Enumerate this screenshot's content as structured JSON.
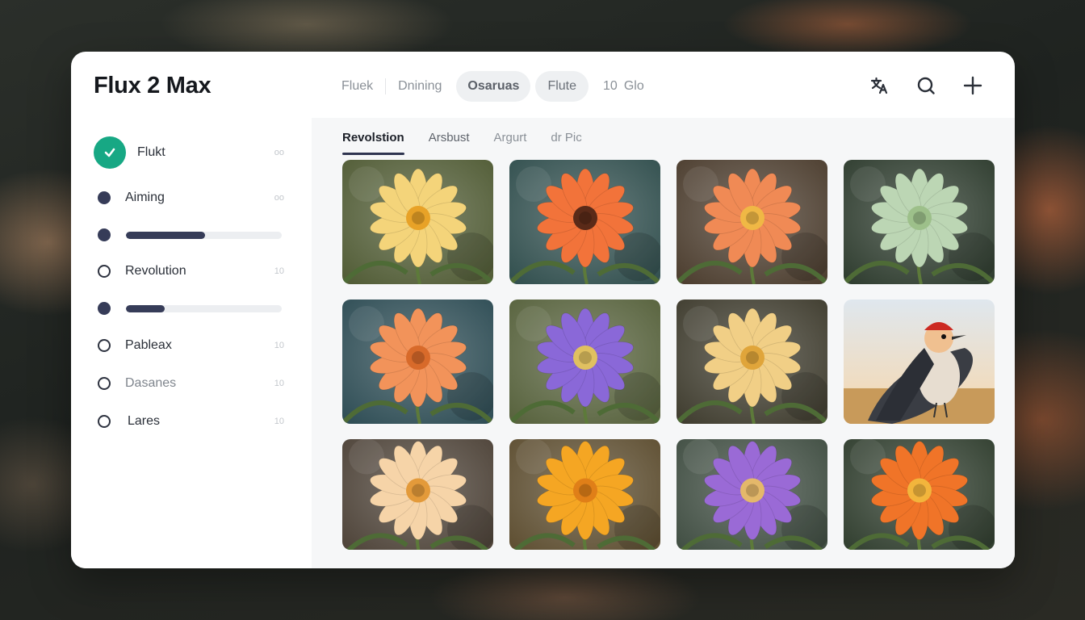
{
  "header": {
    "title": "Flux 2 Max",
    "nav": [
      {
        "label": "Fluek",
        "style": "plain"
      },
      {
        "label": "Dnining",
        "style": "plain"
      },
      {
        "label": "Osaruas",
        "style": "pill-strong"
      },
      {
        "label": "Flute",
        "style": "pill"
      },
      {
        "label": "10",
        "style": "plain"
      },
      {
        "label": "Glo",
        "style": "plain"
      }
    ],
    "actions": [
      "translate-icon",
      "search-icon",
      "plus-icon"
    ]
  },
  "sidebar": {
    "items": [
      {
        "type": "badge",
        "label": "Flukt",
        "count": "oo",
        "icon": "check-icon",
        "accent": "#17a884"
      },
      {
        "type": "filled",
        "label": "Aiming",
        "count": "oo"
      },
      {
        "type": "progress",
        "progress": 0.51
      },
      {
        "type": "ring",
        "label": "Revolution",
        "count": "10"
      },
      {
        "type": "progress",
        "progress": 0.25
      },
      {
        "type": "ring",
        "label": "Pableax",
        "count": "10"
      },
      {
        "type": "ring",
        "label": "Dasanes",
        "count": "10"
      },
      {
        "type": "ring",
        "label": "Lares",
        "count": "10"
      }
    ]
  },
  "content": {
    "tabs": [
      "Revolstion",
      "Arsbust",
      "Argurt",
      "dr Pic"
    ],
    "active_tab": 0,
    "gallery": [
      {
        "subject": "flower",
        "petal": "#f4d47a",
        "center": "#e8a227",
        "bg": "#4f5a33"
      },
      {
        "subject": "flower",
        "petal": "#f2733a",
        "center": "#5a2a18",
        "bg": "#2f4d4c"
      },
      {
        "subject": "flower",
        "petal": "#f08a55",
        "center": "#f0b845",
        "bg": "#4a3b2c"
      },
      {
        "subject": "flower",
        "petal": "#bcd6b4",
        "center": "#9dc08a",
        "bg": "#2c3a2c"
      },
      {
        "subject": "flower",
        "petal": "#f2935a",
        "center": "#d86a2a",
        "bg": "#2c4b53"
      },
      {
        "subject": "flower",
        "petal": "#8a68d8",
        "center": "#e0c060",
        "bg": "#55603a"
      },
      {
        "subject": "flower",
        "petal": "#f1cf86",
        "center": "#e0a53a",
        "bg": "#3d3a2c"
      },
      {
        "subject": "bird",
        "sky": "#dfe7ee",
        "ground": "#c89a5a"
      },
      {
        "subject": "flower",
        "petal": "#f6d4a8",
        "center": "#e39a3a",
        "bg": "#4a3f34"
      },
      {
        "subject": "flower",
        "petal": "#f5a623",
        "center": "#e07f18",
        "bg": "#5a4a2c"
      },
      {
        "subject": "flower",
        "petal": "#9a6ad6",
        "center": "#e4b86a",
        "bg": "#3c4a3e"
      },
      {
        "subject": "flower",
        "petal": "#f07428",
        "center": "#f2b53c",
        "bg": "#2c3a2a"
      }
    ]
  }
}
